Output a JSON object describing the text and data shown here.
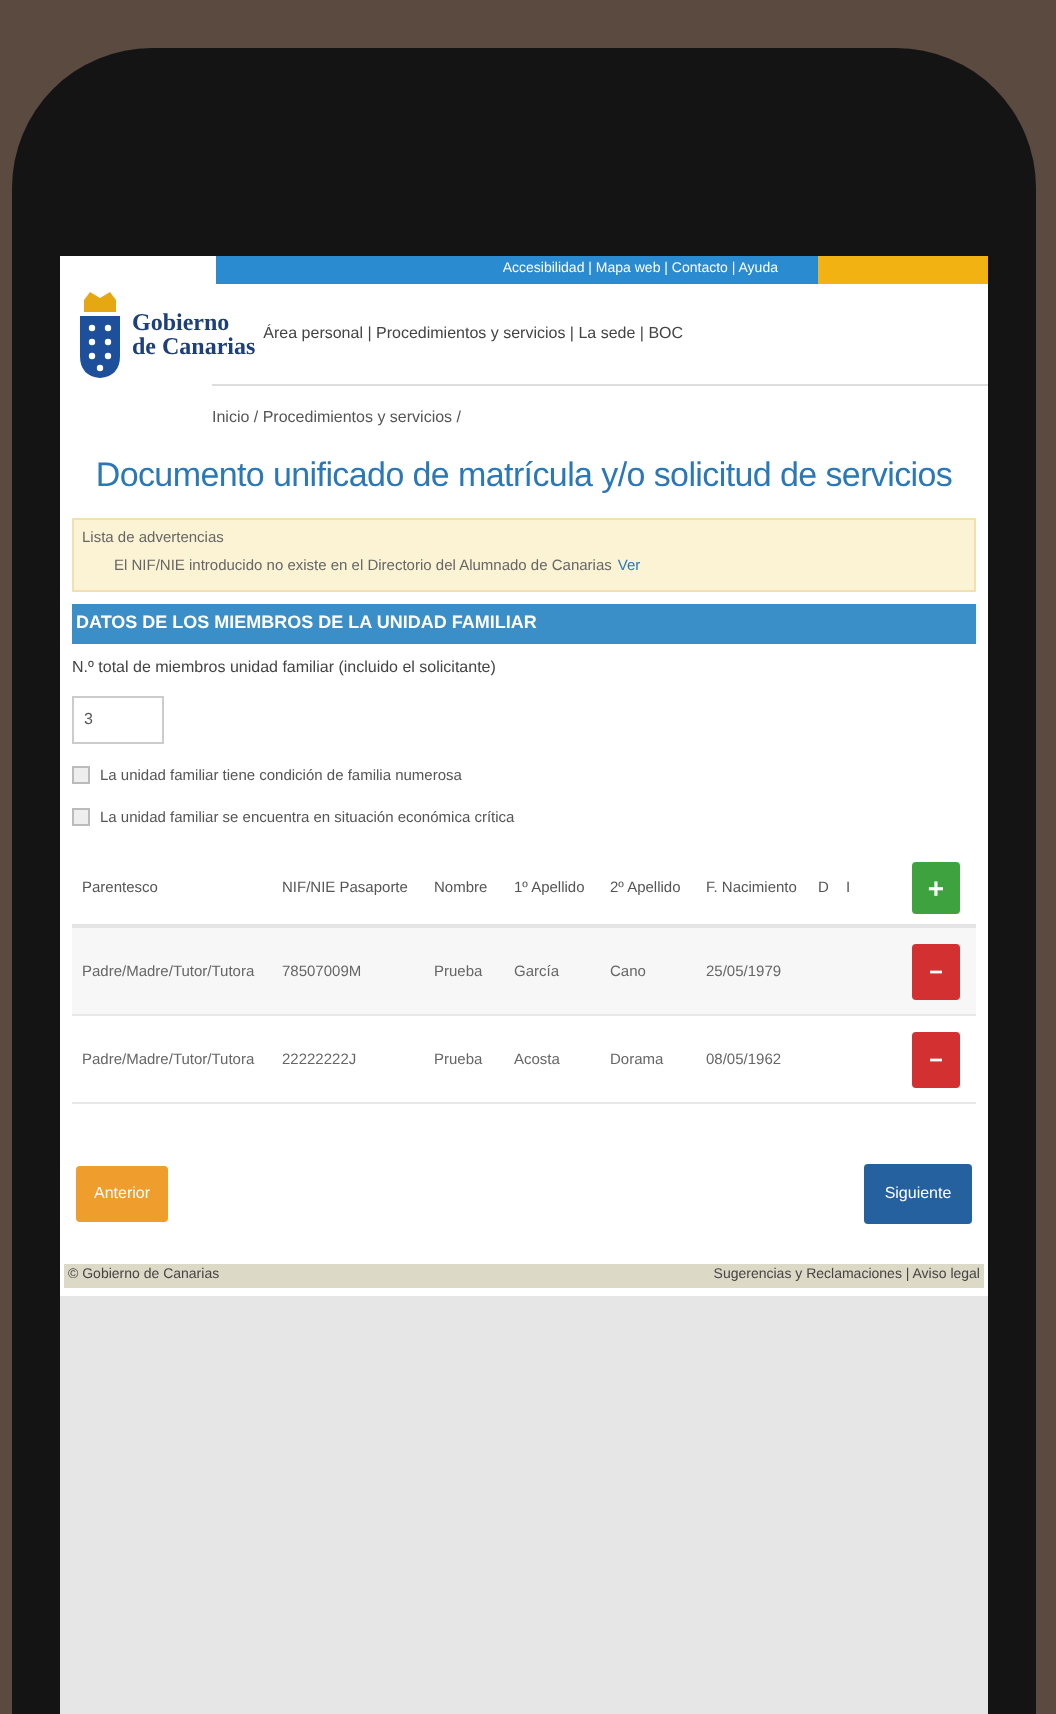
{
  "top_bar": {
    "links": "Accesibilidad | Mapa web | Contacto | Ayuda"
  },
  "header": {
    "logo_line_1": "Gobierno",
    "logo_line_2": "de Canarias",
    "nav": "Área personal | Procedimientos y servicios | La sede | BOC"
  },
  "breadcrumb": "Inicio / Procedimientos y servicios /",
  "title": "Documento unificado de matrícula y/o solicitud de servicios",
  "warnings": {
    "title": "Lista de advertencias",
    "message": "El NIF/NIE introducido no existe en el Directorio del Alumnado de Canarias",
    "link": "Ver"
  },
  "section_header": "DATOS DE LOS MIEMBROS DE LA UNIDAD FAMILIAR",
  "members_total": {
    "label": "N.º total de miembros unidad familiar (incluido el solicitante)",
    "value": "3"
  },
  "checkboxes": [
    {
      "label": "La unidad familiar tiene condición de familia numerosa",
      "checked": false
    },
    {
      "label": "La unidad familiar se encuentra en situación económica crítica",
      "checked": false
    }
  ],
  "table": {
    "columns": [
      "Parentesco",
      "NIF/NIE Pasaporte",
      "Nombre",
      "1º Apellido",
      "2º Apellido",
      "F. Nacimiento",
      "D",
      "I"
    ],
    "add_button": "+",
    "rows": [
      {
        "cells": [
          "Padre/Madre/Tutor/Tutora",
          "78507009M",
          "Prueba",
          "García",
          "Cano",
          "25/05/1979"
        ],
        "remove_button": "−"
      },
      {
        "cells": [
          "Padre/Madre/Tutor/Tutora",
          "22222222J",
          "Prueba",
          "Acosta",
          "Dorama",
          "08/05/1962"
        ],
        "remove_button": "−"
      }
    ]
  },
  "buttons": {
    "previous": "Anterior",
    "next": "Siguiente"
  },
  "footer": {
    "left": "© Gobierno de Canarias",
    "right": "Sugerencias y Reclamaciones | Aviso legal"
  }
}
